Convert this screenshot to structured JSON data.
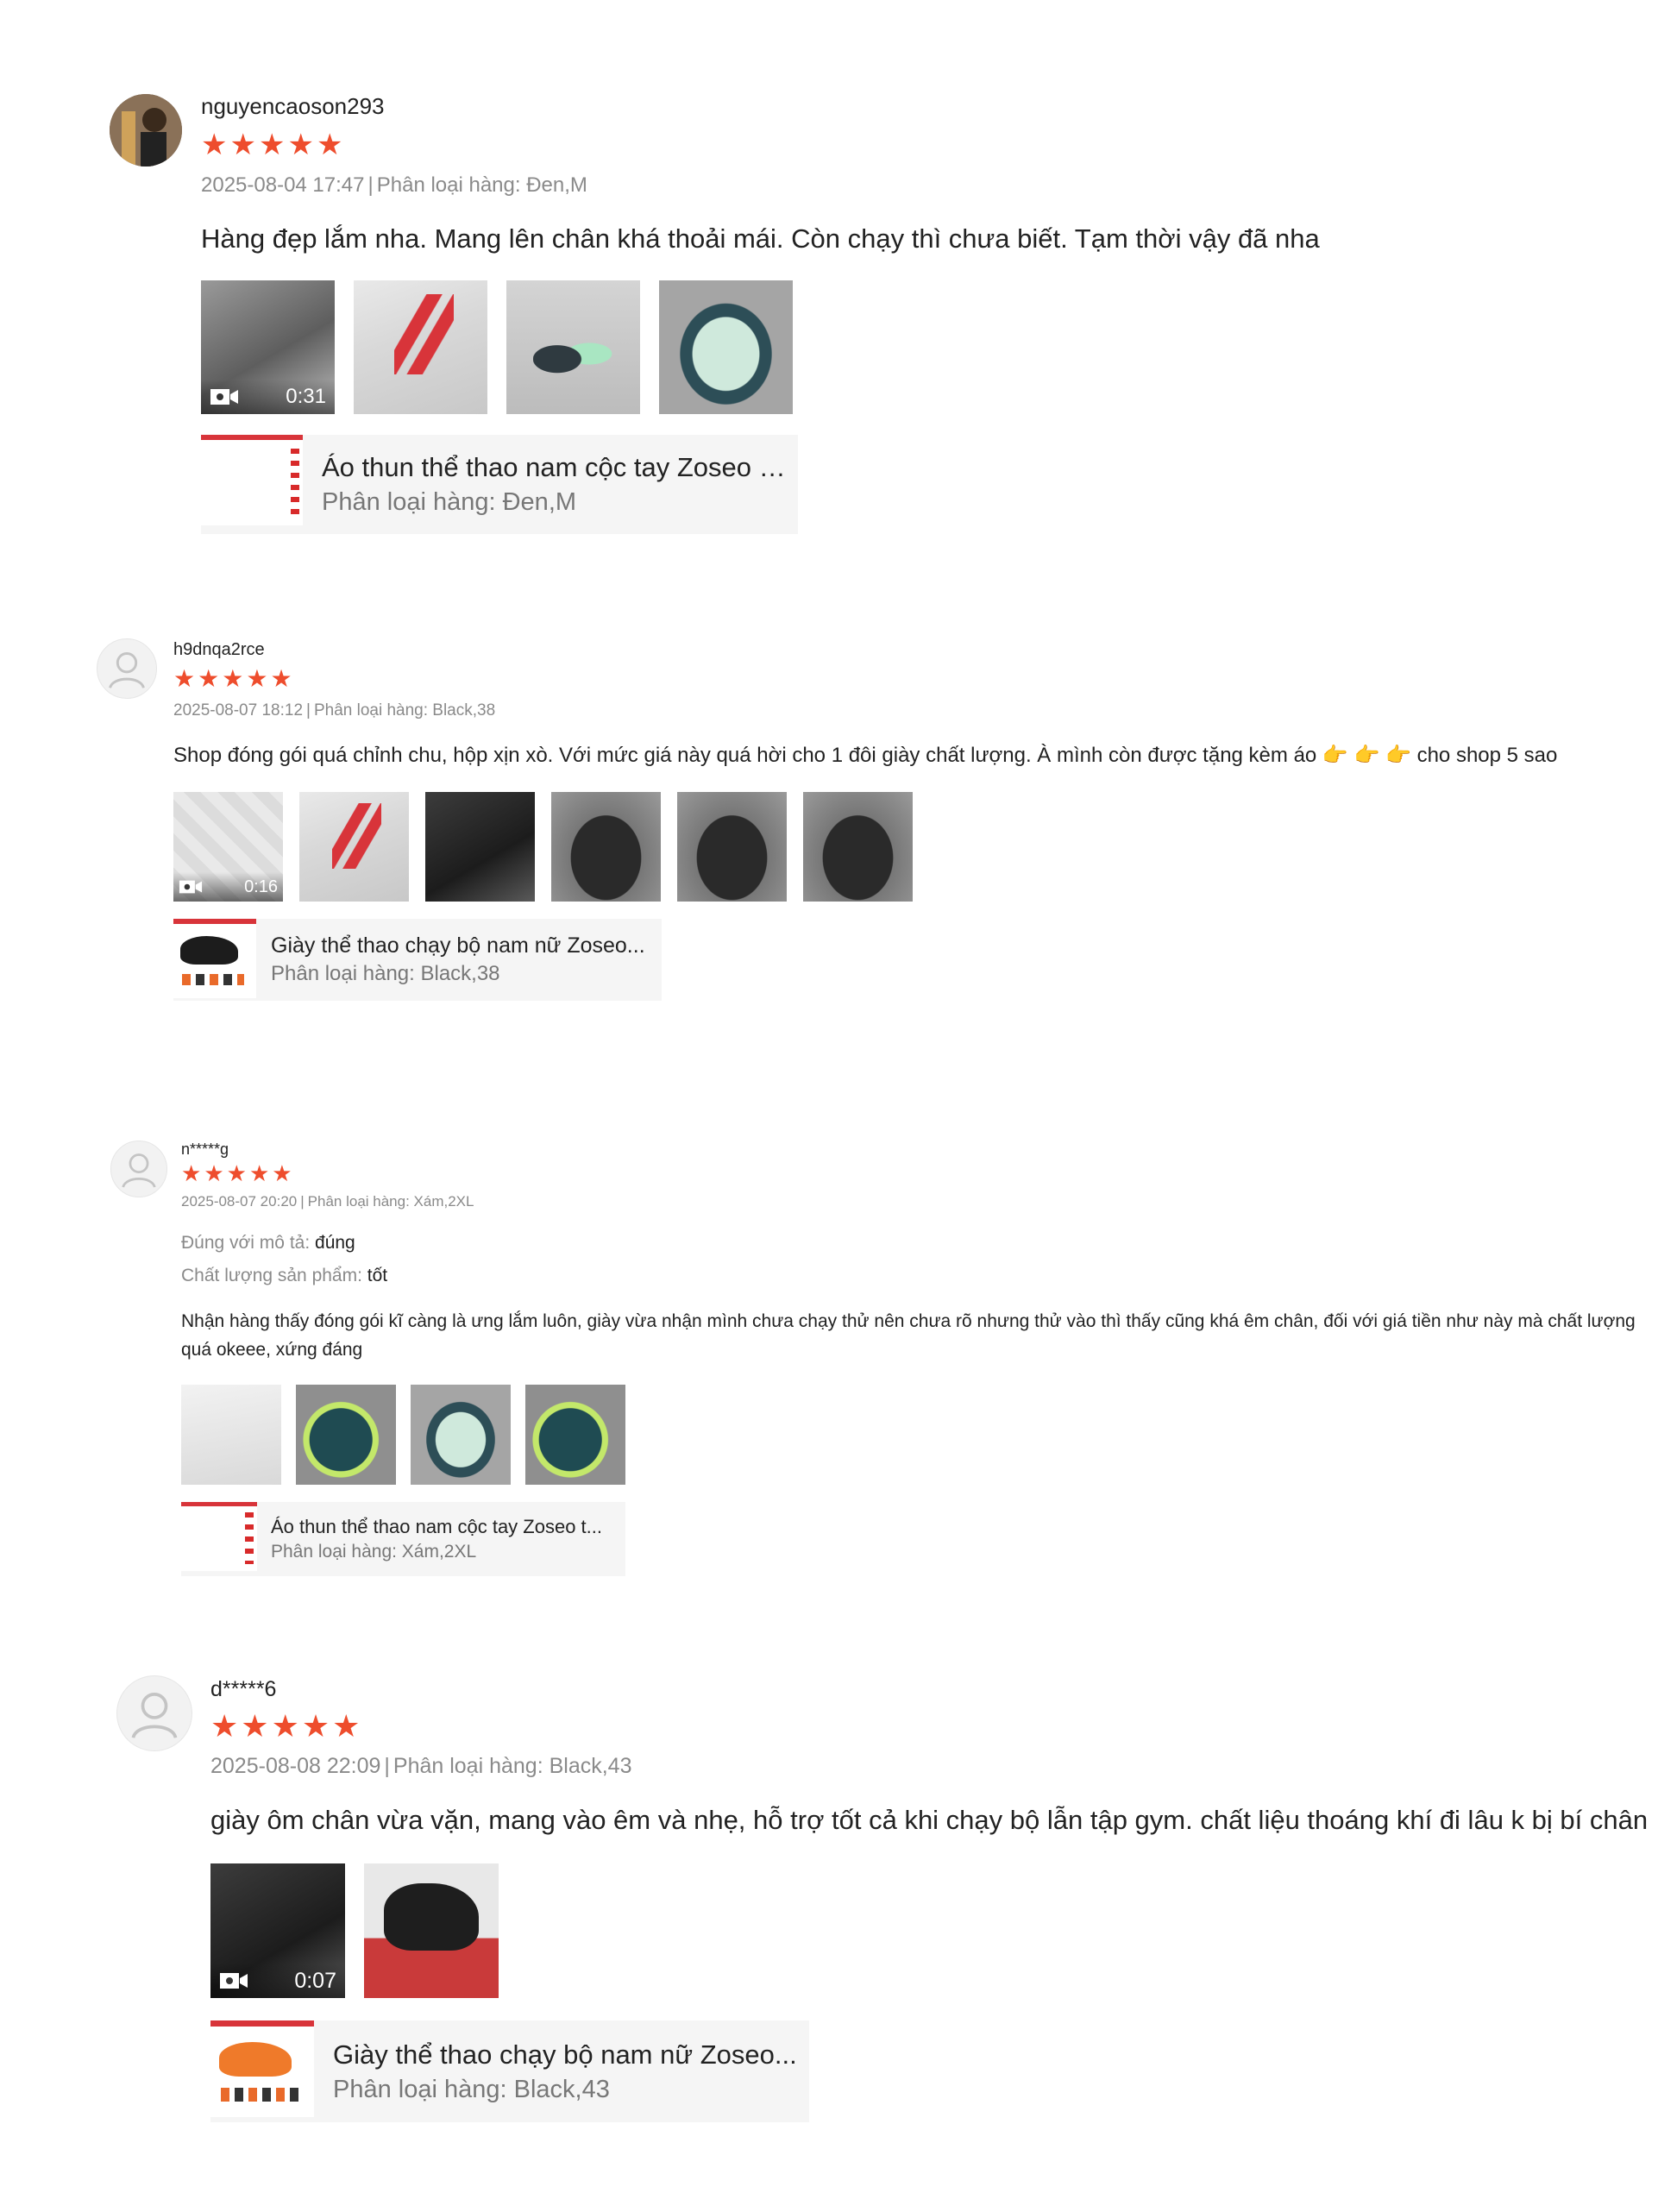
{
  "reviews": [
    {
      "username": "nguyencaoson293",
      "rating": 5,
      "date": "2025-08-04 17:47",
      "variant_label": "Phân loại hàng: Đen,M",
      "attributes": [],
      "content": "Hàng đẹp lắm nha. Mang lên chân khá thoải mái. Còn chạy thì chưa biết. Tạm thời vậy đã nha",
      "video_duration": "0:31",
      "product": {
        "title": "Áo thun thể thao nam cộc tay Zoseo t...",
        "variant": "Phân loại hàng: Đen,M"
      }
    },
    {
      "username": "h9dnqa2rce",
      "rating": 5,
      "date": "2025-08-07 18:12",
      "variant_label": "Phân loại hàng: Black,38",
      "attributes": [],
      "content": "Shop đóng gói quá chỉnh chu, hộp xịn xò. Với mức giá này quá hời cho 1 đôi giày chất lượng. À mình còn được tặng kèm áo 👉 👉 👉 cho shop 5 sao",
      "video_duration": "0:16",
      "product": {
        "title": "Giày thể thao chạy bộ nam nữ Zoseo...",
        "variant": "Phân loại hàng: Black,38"
      }
    },
    {
      "username": "n*****g",
      "rating": 5,
      "date": "2025-08-07 20:20",
      "variant_label": "Phân loại hàng: Xám,2XL",
      "attributes": [
        {
          "label": "Đúng với mô tả:",
          "value": "đúng"
        },
        {
          "label": "Chất lượng sản phẩm:",
          "value": "tốt"
        }
      ],
      "content": "Nhận hàng thấy đóng gói kĩ càng là ưng lắm luôn, giày vừa nhận mình chưa chạy thử nên chưa rõ nhưng thử vào thì thấy cũng khá êm chân, đối với giá tiền như này mà chất lượng quá okeee, xứng đáng",
      "video_duration": "",
      "product": {
        "title": "Áo thun thể thao nam cộc tay Zoseo t...",
        "variant": "Phân loại hàng: Xám,2XL"
      }
    },
    {
      "username": "d*****6",
      "rating": 5,
      "date": "2025-08-08 22:09",
      "variant_label": "Phân loại hàng: Black,43",
      "attributes": [],
      "content": "giày ôm chân vừa vặn, mang vào êm và nhẹ, hỗ trợ tốt cả khi chạy bộ lẫn tập gym. chất liệu thoáng khí đi lâu k bị bí chân",
      "video_duration": "0:07",
      "product": {
        "title": "Giày thể thao chạy bộ nam nữ Zoseo...",
        "variant": "Phân loại hàng: Black,43"
      }
    }
  ],
  "meta_separator": "|",
  "colors": {
    "star": "#ee4d2d",
    "meta": "#8a8a8a",
    "product_bg": "#f5f5f5"
  }
}
